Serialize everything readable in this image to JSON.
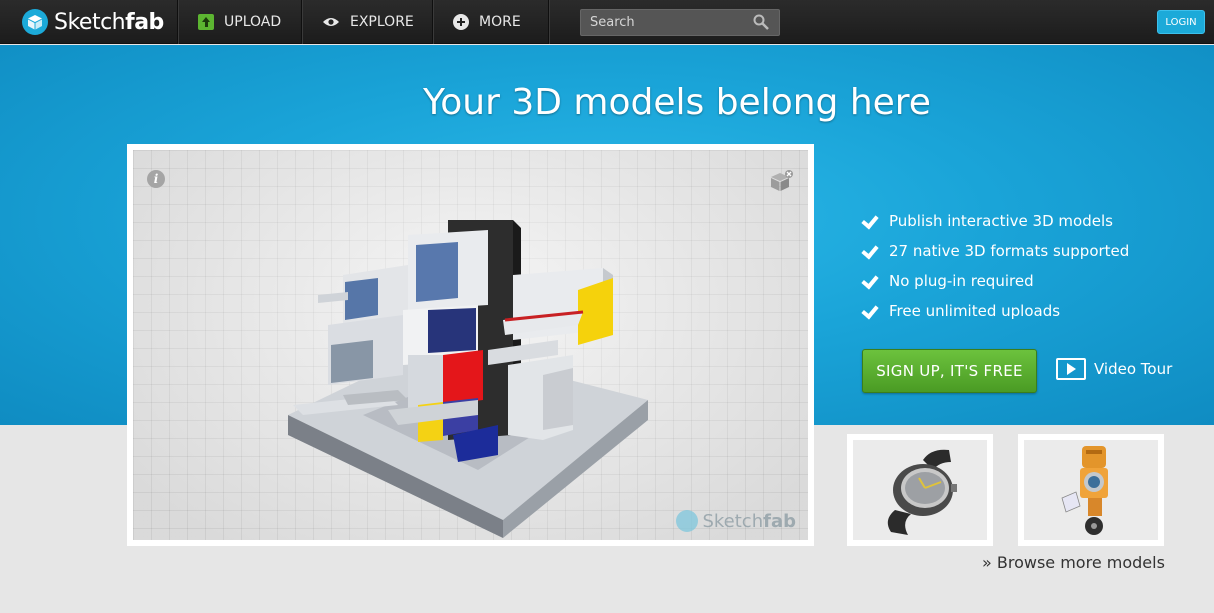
{
  "brand": {
    "name_light": "Sketch",
    "name_bold": "fab",
    "accent": "#1caad9"
  },
  "nav": {
    "items": [
      {
        "label": "UPLOAD",
        "icon": "upload-icon"
      },
      {
        "label": "EXPLORE",
        "icon": "eye-icon"
      },
      {
        "label": "MORE",
        "icon": "plus-icon"
      }
    ],
    "search_placeholder": "Search",
    "login_label": "LOGIN"
  },
  "hero": {
    "title": "Your 3D models belong here",
    "features": [
      "Publish interactive 3D models",
      "27 native 3D formats supported",
      "No plug-in required",
      "Free unlimited uploads"
    ],
    "signup_label": "SIGN UP, IT'S FREE",
    "video_tour_label": "Video Tour",
    "signup_color": "#5aae2e"
  },
  "viewer": {
    "info_glyph": "i",
    "watermark_light": "Sketch",
    "watermark_bold": "fab"
  },
  "thumbnails": [
    {
      "subject": "wristwatch"
    },
    {
      "subject": "orange-robot"
    }
  ],
  "browse_label": "» Browse more models"
}
